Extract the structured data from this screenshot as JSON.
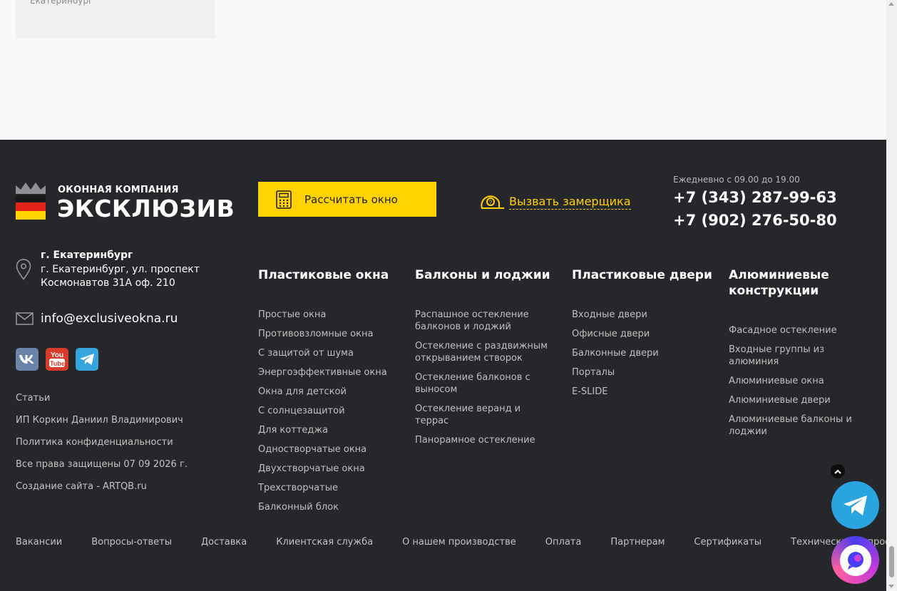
{
  "top": {
    "card_text": "Екатеринбург"
  },
  "logo": {
    "small": "ОКОННАЯ КОМПАНИЯ",
    "big": "ЭКСКЛЮЗИВ"
  },
  "calc_button": {
    "label": "Рассчитать окно",
    "icon": "calculator-icon"
  },
  "measure": {
    "label": "Вызвать замерщика",
    "icon": "tape-measure-icon"
  },
  "contacts": {
    "hours": "Ежедневно с 09.00 до 19.00",
    "phone1": "+7 (343) 287-99-63",
    "phone2": "+7 (902) 276-50-80",
    "city": "г. Екатеринбург",
    "street": "г. Екатеринбург, ул. проспект Космонавтов 31А оф. 210",
    "email": "info@exclusiveokna.ru"
  },
  "socials": [
    {
      "name": "vk",
      "label": "vk"
    },
    {
      "name": "youtube",
      "label": "You Tube"
    },
    {
      "name": "telegram",
      "label": ""
    }
  ],
  "left_links": [
    "Статьи",
    "ИП Коркин Даниил Владимирович",
    "Политика конфиденциальности",
    "Все права защищены 07 09 2026 г.",
    "Создание сайта - ARTQB.ru"
  ],
  "columns": [
    {
      "title": "Пластиковые окна",
      "links": [
        "Простые окна",
        "Противовзломные окна",
        "С защитой от шума",
        "Энергоэффективные окна",
        "Окна для детской",
        "С солнцезащитой",
        "Для коттеджа",
        "Одностворчатые окна",
        "Двухстворчатые окна",
        "Трехстворчатые",
        "Балконный блок"
      ]
    },
    {
      "title": "Балконы и лоджии",
      "links": [
        "Распашное остекление балконов и лоджий",
        "Остекление с раздвижным открыванием створок",
        "Остекление балконов с выносом",
        "Остекление веранд и террас",
        "Панорамное остекление"
      ]
    },
    {
      "title": "Пластиковые двери",
      "links": [
        "Входные двери",
        "Офисные двери",
        "Балконные двери",
        "Порталы",
        "E-SLIDE"
      ]
    },
    {
      "title": "Алюминиевые конструкции",
      "links": [
        "Фасадное остекление",
        "Входные группы из алюминия",
        "Алюминиевые окна",
        "Алюминиевые двери",
        "Алюминиевые балконы и лоджии"
      ]
    }
  ],
  "bottom_links": [
    "Вакансии",
    "Вопросы-ответы",
    "Доставка",
    "Клиентская служба",
    "О нашем производстве",
    "Оплата",
    "Партнерам",
    "Сертификаты",
    "Технические вопросы"
  ],
  "colors": {
    "footer_bg": "#25272b",
    "accent": "#ffd200",
    "page_bg": "#f8f9fb"
  }
}
